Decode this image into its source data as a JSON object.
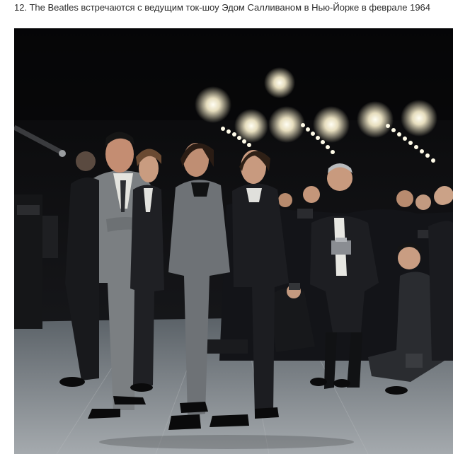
{
  "caption": "12. The Beatles встречаются с ведущим ток-шоу Эдом Салливаном в Нью-Йорке в феврале 1964",
  "photo": {
    "subject": "photo",
    "colors": {
      "backdrop": "#0b0b0d",
      "floor": "#8d9296",
      "suit_gray": "#7b7f82",
      "suit_dark": "#1a1b1e",
      "light": "#fffbe8"
    }
  }
}
